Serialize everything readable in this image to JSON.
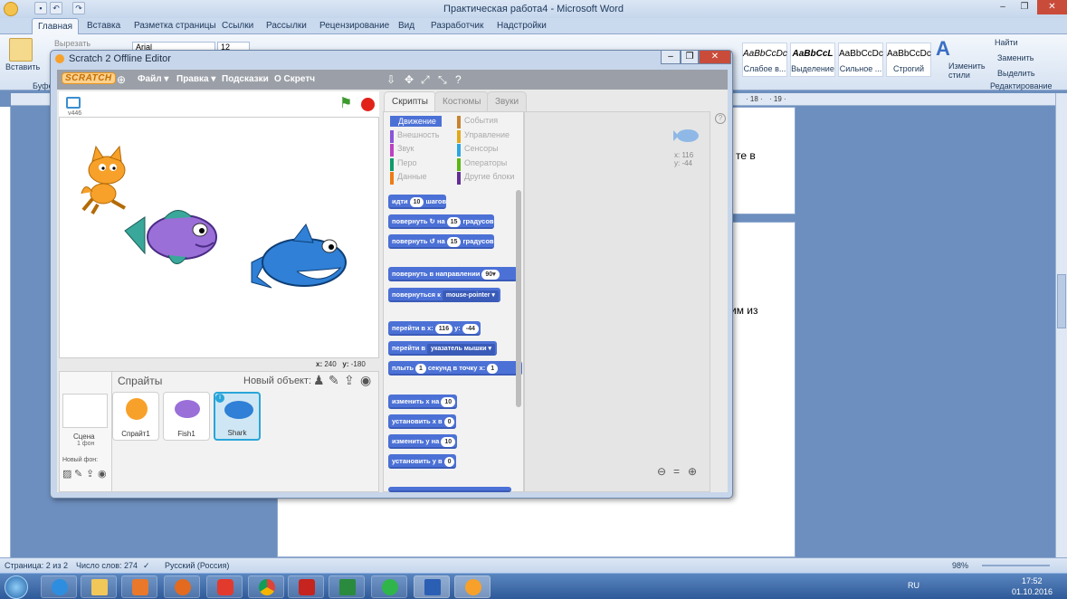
{
  "word": {
    "title": "Практическая работа4 - Microsoft Word",
    "tabs": [
      "Главная",
      "Вставка",
      "Разметка страницы",
      "Ссылки",
      "Рассылки",
      "Рецензирование",
      "Вид",
      "Разработчик",
      "Надстройки"
    ],
    "paste_label": "Вставить",
    "cut_label": "Вырезать",
    "clipboard_group": "Буфер",
    "font_name": "Arial",
    "font_size": "12",
    "styles": [
      {
        "preview": "AaBbCcDc",
        "name": "Слабое в..."
      },
      {
        "preview": "AaBbCcL",
        "name": "Выделение"
      },
      {
        "preview": "AaBbCcDc",
        "name": "Сильное ..."
      },
      {
        "preview": "AaBbCcDc",
        "name": "Строгий"
      }
    ],
    "change_styles": "Изменить стили",
    "find": "Найти",
    "replace": "Заменить",
    "select": "Выделить",
    "editing_group": "Редактирование",
    "doc_fragment_1": "те в",
    "doc_fragment_2": "им из",
    "ruler_marks": [
      "· 18 ·",
      "· 19 ·"
    ],
    "status": {
      "page": "Страница: 2 из 2",
      "words": "Число слов: 274",
      "language": "Русский (Россия)",
      "zoom": "98%"
    },
    "tray": {
      "lang": "RU",
      "time": "17:52",
      "date": "01.10.2016"
    }
  },
  "scratch": {
    "title": "Scratch 2 Offline Editor",
    "logo": "SCRATCH",
    "menu": [
      "Файл ▾",
      "Правка ▾",
      "Подсказки",
      "О Скретч"
    ],
    "version": "v446",
    "stage_coords": {
      "x_label": "x:",
      "x": "240",
      "y_label": "y:",
      "y": "-180"
    },
    "sprites_header": "Спрайты",
    "new_object": "Новый объект:",
    "scene": {
      "label": "Сцена",
      "sub": "1 фон"
    },
    "new_backdrop": "Новый фон:",
    "sprites": [
      "Спрайт1",
      "Fish1",
      "Shark"
    ],
    "tabs": [
      "Скрипты",
      "Костюмы",
      "Звуки"
    ],
    "categories_left": [
      "Движение",
      "Внешность",
      "Звук",
      "Перо",
      "Данные"
    ],
    "categories_right": [
      "События",
      "Управление",
      "Сенсоры",
      "Операторы",
      "Другие блоки"
    ],
    "category_colors": {
      "Движение": "#4c71d6",
      "Внешность": "#8a55d7",
      "Звук": "#bb42c3",
      "Перо": "#0e9a6c",
      "Данные": "#ee7d16",
      "События": "#c88330",
      "Управление": "#e1a91a",
      "Сенсоры": "#2ca5e2",
      "Операторы": "#5cb712",
      "Другие блоки": "#632d99"
    },
    "blocks": {
      "move": {
        "a": "идти",
        "v": "10",
        "b": "шагов"
      },
      "turn_right": {
        "a": "повернуть",
        "icon": "↻",
        "b": "на",
        "v": "15",
        "c": "градусов"
      },
      "turn_left": {
        "a": "повернуть",
        "icon": "↺",
        "b": "на",
        "v": "15",
        "c": "градусов"
      },
      "point_dir": {
        "a": "повернуть в направлении",
        "v": "90▾"
      },
      "point_towards": {
        "a": "повернуться к",
        "v": "mouse-pointer ▾"
      },
      "goto_xy": {
        "a": "перейти в x:",
        "x": "116",
        "b": "y:",
        "y": "-44"
      },
      "goto": {
        "a": "перейти в",
        "v": "указатель мышки ▾"
      },
      "glide": {
        "a": "плыть",
        "v": "1",
        "b": "секунд в точку x:",
        "x": "1"
      },
      "change_x": {
        "a": "изменить х на",
        "v": "10"
      },
      "set_x": {
        "a": "установить х в",
        "v": "0"
      },
      "change_y": {
        "a": "изменить у на",
        "v": "10"
      },
      "set_y": {
        "a": "установить у в",
        "v": "0"
      }
    },
    "sprite_info": {
      "x": "x: 116",
      "y": "y: -44"
    },
    "zoom": [
      "⊖",
      "=",
      "⊕"
    ],
    "help": "?"
  }
}
